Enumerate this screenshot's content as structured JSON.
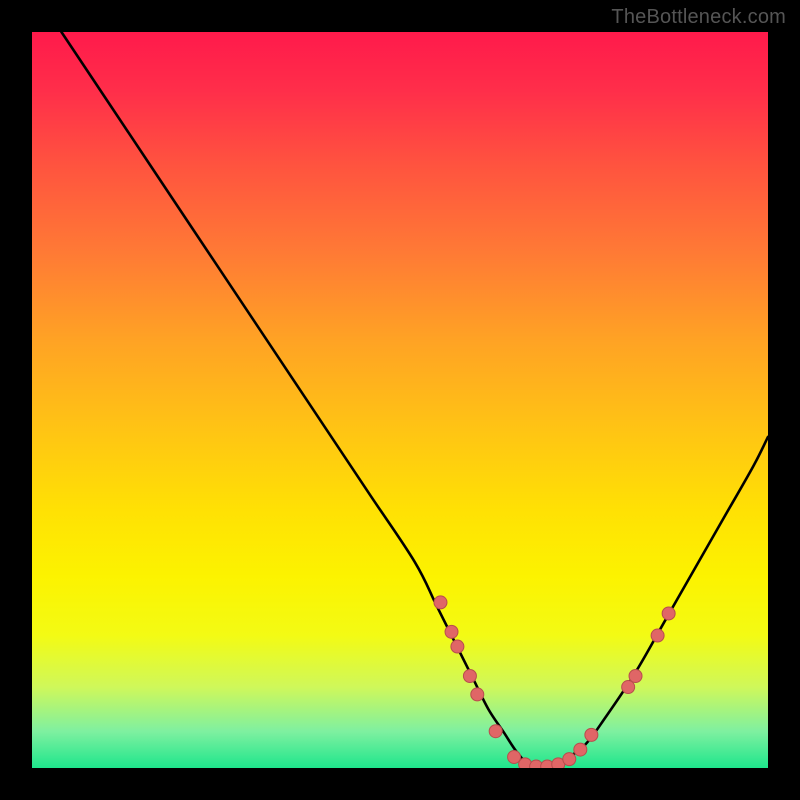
{
  "watermark": "TheBottleneck.com",
  "colors": {
    "background": "#000000",
    "curve": "#000000",
    "dot_fill": "#e06666",
    "dot_stroke": "#b84d4d",
    "gradient_top": "#ff1a4b",
    "gradient_bottom": "#1ee68c"
  },
  "chart_data": {
    "type": "line",
    "title": "",
    "xlabel": "",
    "ylabel": "",
    "xlim": [
      0,
      100
    ],
    "ylim": [
      0,
      100
    ],
    "grid": false,
    "legend": false,
    "series": [
      {
        "name": "bottleneck-curve",
        "x": [
          4,
          10,
          16,
          22,
          28,
          34,
          40,
          46,
          52,
          55,
          58,
          60,
          62,
          64,
          66,
          68,
          70,
          72,
          75,
          78,
          82,
          86,
          90,
          94,
          98,
          100
        ],
        "y": [
          100,
          91,
          82,
          73,
          64,
          55,
          46,
          37,
          28,
          22,
          16,
          12,
          8,
          5,
          2,
          0,
          0,
          1,
          3,
          7,
          13,
          20,
          27,
          34,
          41,
          45
        ]
      }
    ],
    "points": [
      {
        "x": 55.5,
        "y": 22.5
      },
      {
        "x": 57.0,
        "y": 18.5
      },
      {
        "x": 57.8,
        "y": 16.5
      },
      {
        "x": 59.5,
        "y": 12.5
      },
      {
        "x": 60.5,
        "y": 10.0
      },
      {
        "x": 63.0,
        "y": 5.0
      },
      {
        "x": 65.5,
        "y": 1.5
      },
      {
        "x": 67.0,
        "y": 0.5
      },
      {
        "x": 68.5,
        "y": 0.2
      },
      {
        "x": 70.0,
        "y": 0.2
      },
      {
        "x": 71.5,
        "y": 0.5
      },
      {
        "x": 73.0,
        "y": 1.2
      },
      {
        "x": 74.5,
        "y": 2.5
      },
      {
        "x": 76.0,
        "y": 4.5
      },
      {
        "x": 81.0,
        "y": 11.0
      },
      {
        "x": 82.0,
        "y": 12.5
      },
      {
        "x": 85.0,
        "y": 18.0
      },
      {
        "x": 86.5,
        "y": 21.0
      }
    ]
  }
}
